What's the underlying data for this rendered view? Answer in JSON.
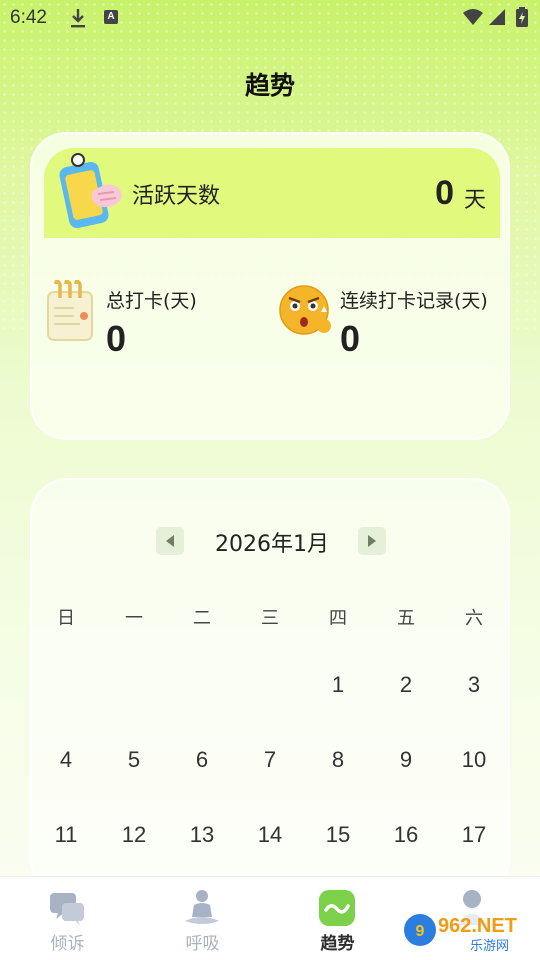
{
  "status_bar": {
    "time": "6:42"
  },
  "page": {
    "title": "趋势"
  },
  "stats": {
    "active_days": {
      "label": "活跃天数",
      "value": "0",
      "unit": "天"
    },
    "total_checkin": {
      "label": "总打卡(天)",
      "value": "0"
    },
    "streak_record": {
      "label": "连续打卡记录(天)",
      "value": "0"
    }
  },
  "calendar": {
    "month_label": "2026年1月",
    "weekdays": [
      "日",
      "一",
      "二",
      "三",
      "四",
      "五",
      "六"
    ],
    "weeks": [
      [
        "",
        "",
        "",
        "",
        "1",
        "2",
        "3"
      ],
      [
        "4",
        "5",
        "6",
        "7",
        "8",
        "9",
        "10"
      ],
      [
        "11",
        "12",
        "13",
        "14",
        "15",
        "16",
        "17"
      ]
    ]
  },
  "tabs": [
    {
      "label": "倾诉",
      "icon": "chat-bubbles-icon",
      "active": false
    },
    {
      "label": "呼吸",
      "icon": "meditation-icon",
      "active": false
    },
    {
      "label": "趋势",
      "icon": "trend-wave-icon",
      "active": true
    },
    {
      "label": "",
      "icon": "person-icon",
      "active": false
    }
  ],
  "watermark": {
    "text_big": "962.NET",
    "text_small": "乐游网"
  },
  "colors": {
    "accent": "#e1fa7d",
    "tab_active": "#7dd04a",
    "tab_inactive": "#aab3c2"
  }
}
